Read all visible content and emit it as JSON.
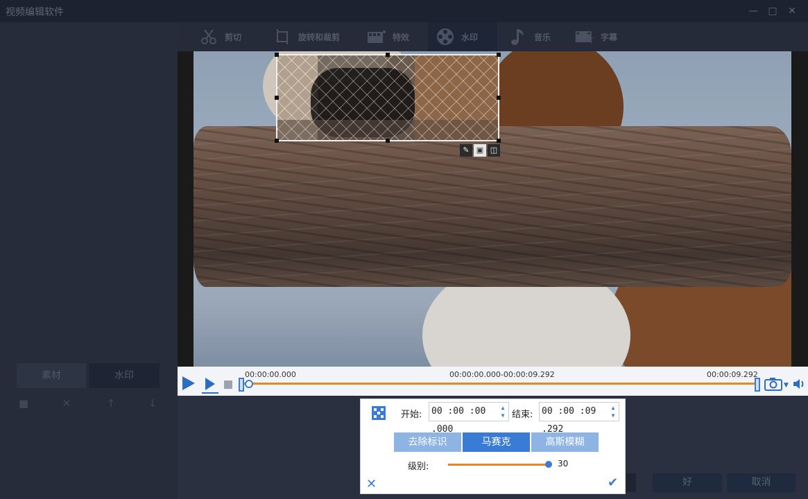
{
  "window": {
    "title": "视频编辑软件"
  },
  "toolbar": {
    "items": [
      {
        "label": "剪切",
        "icon": "scissors-icon"
      },
      {
        "label": "旋转和裁剪",
        "icon": "crop-rotate-icon"
      },
      {
        "label": "特效",
        "icon": "effects-icon"
      },
      {
        "label": "水印",
        "icon": "film-reel-icon",
        "active": true
      },
      {
        "label": "音乐",
        "icon": "music-note-icon"
      },
      {
        "label": "字幕",
        "icon": "subtitle-icon"
      }
    ]
  },
  "left_panel": {
    "tabs": [
      "素材",
      "水印"
    ]
  },
  "timeline": {
    "start_time": "00:00:00.000",
    "range": "00:00:00.000-00:00:09.292",
    "end_time": "00:00:09.292"
  },
  "mosaic_panel": {
    "start_label": "开始:",
    "start_value": "00 :00 :00 .000",
    "end_label": "结束:",
    "end_value": "00 :00 :09 .292",
    "modes": [
      {
        "label": "去除标识",
        "active": false
      },
      {
        "label": "马赛克",
        "active": true
      },
      {
        "label": "高斯模糊",
        "active": false
      }
    ],
    "level_label": "级别:",
    "level_value": "30",
    "level_fraction": 1.0
  },
  "footer": {
    "ok_label": "好",
    "cancel_label": "取消"
  },
  "colors": {
    "accent": "#3a7bd5",
    "track": "#e8871e"
  }
}
